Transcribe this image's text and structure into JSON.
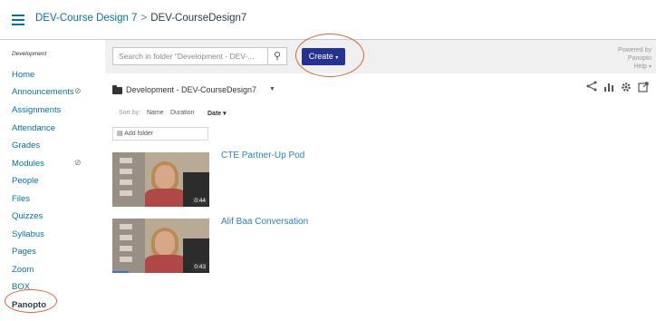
{
  "header": {
    "course_link": "DEV-Course Design 7",
    "separator": ">",
    "current": "DEV-CourseDesign7"
  },
  "sidebar": {
    "context_label": "Development",
    "items": [
      {
        "label": "Home"
      },
      {
        "label": "Announcements",
        "hidden_icon": "eye-slash-icon"
      },
      {
        "label": "Assignments"
      },
      {
        "label": "Attendance"
      },
      {
        "label": "Grades"
      },
      {
        "label": "Modules",
        "hidden_icon": "eye-slash-icon"
      },
      {
        "label": "People"
      },
      {
        "label": "Files"
      },
      {
        "label": "Quizzes"
      },
      {
        "label": "Syllabus"
      },
      {
        "label": "Pages"
      },
      {
        "label": "Zoom"
      },
      {
        "label": "BOX"
      },
      {
        "label": "Panopto",
        "active": true
      }
    ]
  },
  "toolbar": {
    "search_placeholder": "Search in folder \"Development - DEV-...",
    "create_label": "Create",
    "powered_line1": "Powered by",
    "powered_line2": "Panopto",
    "help_label": "Help"
  },
  "folder": {
    "name": "Development - DEV-CourseDesign7",
    "tools": [
      "share-icon",
      "stats-icon",
      "settings-icon",
      "open-external-icon"
    ]
  },
  "sort": {
    "label": "Sort by:",
    "name": "Name",
    "duration": "Duration",
    "date": "Date"
  },
  "add_folder_label": "Add folder",
  "sessions": [
    {
      "title": "CTE Partner-Up Pod",
      "duration": "0:44"
    },
    {
      "title": "Alif Baa Conversation",
      "duration": "0:43",
      "progress": 0.17
    }
  ],
  "colors": {
    "canvas_link": "#0770a3",
    "create_button": "#25328f",
    "annotation_circle": "#e0623a",
    "session_title": "#2c7fbf"
  }
}
